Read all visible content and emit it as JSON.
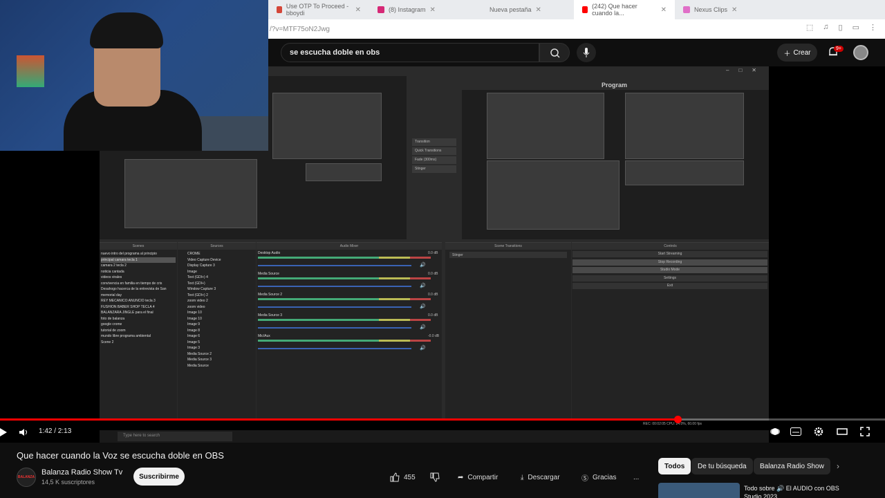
{
  "browser": {
    "tabs": [
      {
        "label": "Use OTP To Proceed - bboydi",
        "fav_color": "#d44638",
        "active": false
      },
      {
        "label": "(8) Instagram",
        "fav_color": "#d62976",
        "active": false
      },
      {
        "label": "Nueva pestaña",
        "fav_color": "#00000000",
        "active": false
      },
      {
        "label": "(242) Que hacer cuando la...",
        "fav_color": "#ff0000",
        "active": true
      },
      {
        "label": "Nexus Clips",
        "fav_color": "#e06fc8",
        "active": false
      }
    ],
    "address": "/?v=MTF75oN2Jwg"
  },
  "youtube": {
    "search_query": "se escucha doble en obs",
    "create_label": "Crear",
    "notifications_badge": "9+"
  },
  "obs": {
    "program_label": "Program",
    "transition": [
      "Transition",
      "Quick Transitions",
      "Fade (300ms)",
      "Stinger"
    ],
    "docks": {
      "scenes_title": "Scenes",
      "sources_title": "Sources",
      "mixer_title": "Audio Mixer",
      "scene_transitions_title": "Scene Transitions",
      "controls_title": "Controls"
    },
    "scenes": [
      "nuevo intro del programa al principio",
      "principal camara tecla 1",
      "camara 2 tecla 2",
      "noticia cantada",
      "videos virales",
      "convivencia en familia en tiempo de cris",
      "Desahogo hacerca de la entrevista de San",
      "memorial day",
      "REY MECANICO ANUNCIO tecla 3",
      "FUSHION BABER SHOP TECLA 4",
      "BALANZARA JINGLE para el final",
      "foto de balanza",
      "google crome",
      "tutorial de zoom",
      "mundo libre programa ambiental",
      "Scene 2"
    ],
    "sources": [
      "CROME",
      "Video Capture Device",
      "Display Capture 3",
      "Image",
      "Text (GDI+) 4",
      "Text (GDI+)",
      "Window Capture 3",
      "Text (GDI+) 2",
      "zoom video 2",
      "zoom video",
      "Image 10",
      "Image 10",
      "Image 9",
      "Image 8",
      "Image 6",
      "Image 5",
      "Image 3",
      "Media Source 2",
      "Media Source 3",
      "Media Source"
    ],
    "mixer": [
      {
        "name": "Desktop Audio",
        "db": "0.0 dB"
      },
      {
        "name": "Media Source",
        "db": "0.0 dB"
      },
      {
        "name": "Media Source 2",
        "db": "0.0 dB"
      },
      {
        "name": "Media Source 3",
        "db": "0.0 dB"
      },
      {
        "name": "Mic/Aux",
        "db": "-0.0 dB"
      }
    ],
    "transition_selected": "Stinger",
    "controls": [
      "Start Streaming",
      "Stop Recording",
      "Studio Mode",
      "Settings",
      "Exit"
    ],
    "status": "REC: 00:02:05   CPU: 24.0%, 60.00 fps"
  },
  "player": {
    "time": "1:42 / 2:13",
    "progress": 0.766,
    "taskbar_search": "Type here to search"
  },
  "video": {
    "title": "Que hacer cuando la Voz se escucha doble en OBS",
    "channel": "Balanza Radio Show Tv",
    "subscribers": "14,5 K suscriptores",
    "avatar_text": "BALANZA",
    "subscribe_label": "Suscribirme",
    "likes": "455",
    "share_label": "Compartir",
    "download_label": "Descargar",
    "thanks_label": "Gracias",
    "more_label": "..."
  },
  "related": {
    "chips": [
      "Todos",
      "De tu búsqueda",
      "Balanza Radio Show"
    ],
    "first_title": "Todo sobre 🔊 El AUDIO con OBS Studio 2023"
  },
  "colors": {
    "yt_red": "#ff0000",
    "obs_bg": "#2b2b2b",
    "dark": "#0f0f0f"
  }
}
